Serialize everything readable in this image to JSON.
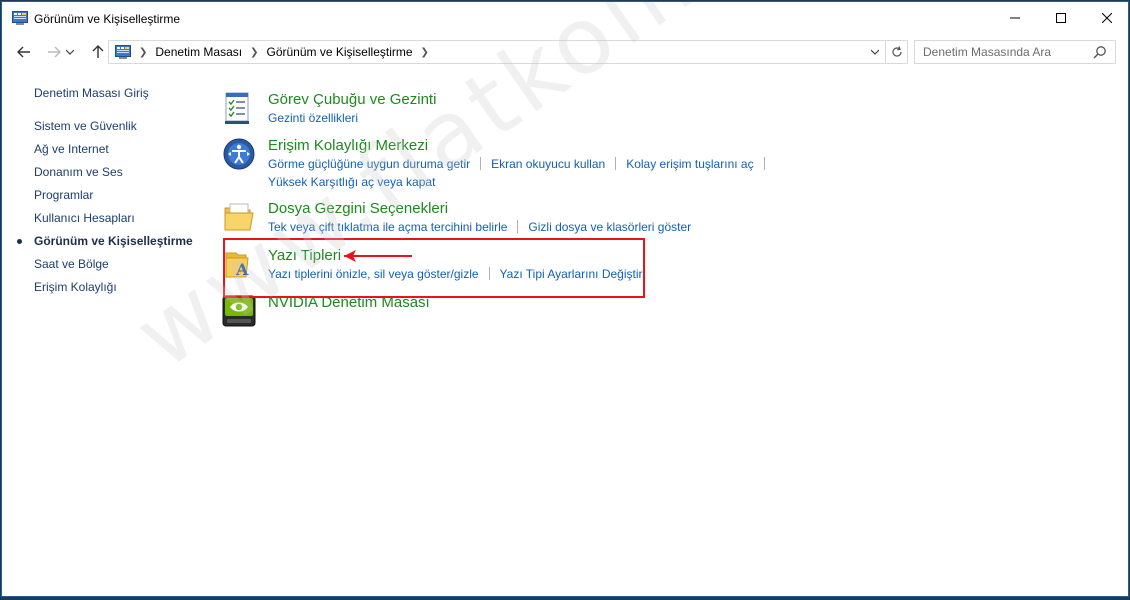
{
  "window": {
    "title": "Görünüm ve Kişiselleştirme",
    "minimize_label": "—",
    "maximize_label": "☐",
    "close_label": "✕"
  },
  "navigation": {
    "back_icon": "back-arrow-icon",
    "forward_icon": "forward-arrow-icon",
    "up_icon": "up-arrow-icon",
    "breadcrumbs": [
      "Denetim Masası",
      "Görünüm ve Kişiselleştirme"
    ],
    "search_placeholder": "Denetim Masasında Ara"
  },
  "sidebar": {
    "home_link": "Denetim Masası Giriş",
    "items": [
      {
        "label": "Sistem ve Güvenlik"
      },
      {
        "label": "Ağ ve Internet"
      },
      {
        "label": "Donanım ve Ses"
      },
      {
        "label": "Programlar"
      },
      {
        "label": "Kullanıcı Hesapları"
      },
      {
        "label": "Görünüm ve Kişiselleştirme",
        "current": true
      },
      {
        "label": "Saat ve Bölge"
      },
      {
        "label": "Erişim Kolaylığı"
      }
    ]
  },
  "categories": [
    {
      "title": "Görev Çubuğu ve Gezinti",
      "icon": "taskbar-checklist-icon",
      "links": [
        "Gezinti özellikleri"
      ]
    },
    {
      "title": "Erişim Kolaylığı Merkezi",
      "icon": "ease-of-access-icon",
      "links": [
        "Görme güçlüğüne uygun duruma getir",
        "Ekran okuyucu kullan",
        "Kolay erişim tuşlarını aç",
        "Yüksek Karşıtlığı aç veya kapat"
      ]
    },
    {
      "title": "Dosya Gezgini Seçenekleri",
      "icon": "folder-options-icon",
      "links": [
        "Tek veya çift tıklatma ile açma tercihini belirle",
        "Gizli dosya ve klasörleri göster"
      ]
    },
    {
      "title": "Yazı Tipleri",
      "icon": "fonts-folder-icon",
      "links": [
        "Yazı tiplerini önizle, sil veya göster/gizle",
        "Yazı Tipi Ayarlarını Değiştir"
      ]
    },
    {
      "title": "NVIDIA Denetim Masası",
      "icon": "nvidia-icon",
      "links": []
    }
  ],
  "watermark": "www.flatkolik.net",
  "colors": {
    "category_title": "#1d8a1d",
    "link": "#1060b8",
    "highlight": "#e8141c",
    "frame": "#1a3b5c"
  }
}
